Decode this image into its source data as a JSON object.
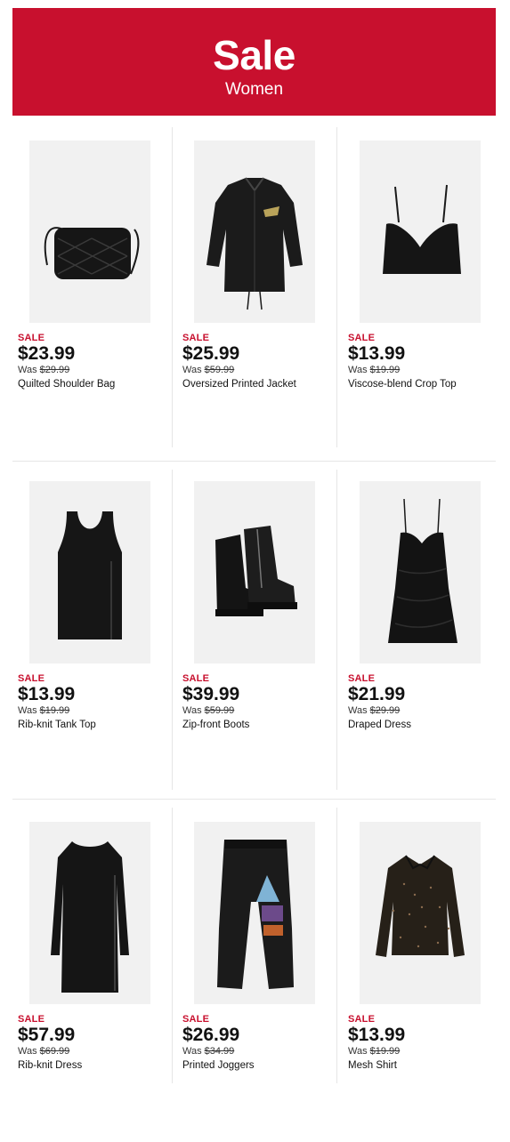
{
  "banner": {
    "title": "Sale",
    "subtitle": "Women"
  },
  "colors": {
    "accent": "#c8102e",
    "text": "#111111",
    "divider": "#e6e6e6"
  },
  "products": [
    {
      "sale_label": "SALE",
      "price": "$23.99",
      "was_label": "Was",
      "was_price": "$29.99",
      "name": "Quilted Shoulder Bag",
      "icon": "bag-icon"
    },
    {
      "sale_label": "SALE",
      "price": "$25.99",
      "was_label": "Was",
      "was_price": "$59.99",
      "name": "Oversized Printed Jacket",
      "icon": "jacket-icon"
    },
    {
      "sale_label": "SALE",
      "price": "$13.99",
      "was_label": "Was",
      "was_price": "$19.99",
      "name": "Viscose-blend Crop Top",
      "icon": "crop-top-icon"
    },
    {
      "sale_label": "SALE",
      "price": "$13.99",
      "was_label": "Was",
      "was_price": "$19.99",
      "name": "Rib-knit Tank Top",
      "icon": "tank-top-icon"
    },
    {
      "sale_label": "SALE",
      "price": "$39.99",
      "was_label": "Was",
      "was_price": "$59.99",
      "name": "Zip-front Boots",
      "icon": "boots-icon"
    },
    {
      "sale_label": "SALE",
      "price": "$21.99",
      "was_label": "Was",
      "was_price": "$29.99",
      "name": "Draped Dress",
      "icon": "dress-icon"
    },
    {
      "sale_label": "SALE",
      "price": "$57.99",
      "was_label": "Was",
      "was_price": "$69.99",
      "name": "Rib-knit Dress",
      "icon": "long-dress-icon"
    },
    {
      "sale_label": "SALE",
      "price": "$26.99",
      "was_label": "Was",
      "was_price": "$34.99",
      "name": "Printed Joggers",
      "icon": "joggers-icon"
    },
    {
      "sale_label": "SALE",
      "price": "$13.99",
      "was_label": "Was",
      "was_price": "$19.99",
      "name": "Mesh Shirt",
      "icon": "shirt-icon"
    }
  ]
}
